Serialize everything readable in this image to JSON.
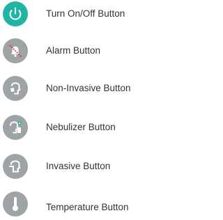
{
  "colors": {
    "power": "#21b3a4",
    "gray": "#9ea3a6",
    "text": "#333333",
    "alarm_slash": "#e0242c",
    "nebulizer_accent": "#21b3a4"
  },
  "items": [
    {
      "label": "Turn On/Off Button",
      "icon": "power-icon"
    },
    {
      "label": "Alarm Button",
      "icon": "alarm-bell-muted-icon"
    },
    {
      "label": "Non-Invasive Button",
      "icon": "non-invasive-mask-icon"
    },
    {
      "label": "Nebulizer Button",
      "icon": "nebulizer-icon"
    },
    {
      "label": "Invasive Button",
      "icon": "invasive-tube-icon"
    },
    {
      "label": "Temperature Button",
      "icon": "thermometer-icon"
    }
  ]
}
